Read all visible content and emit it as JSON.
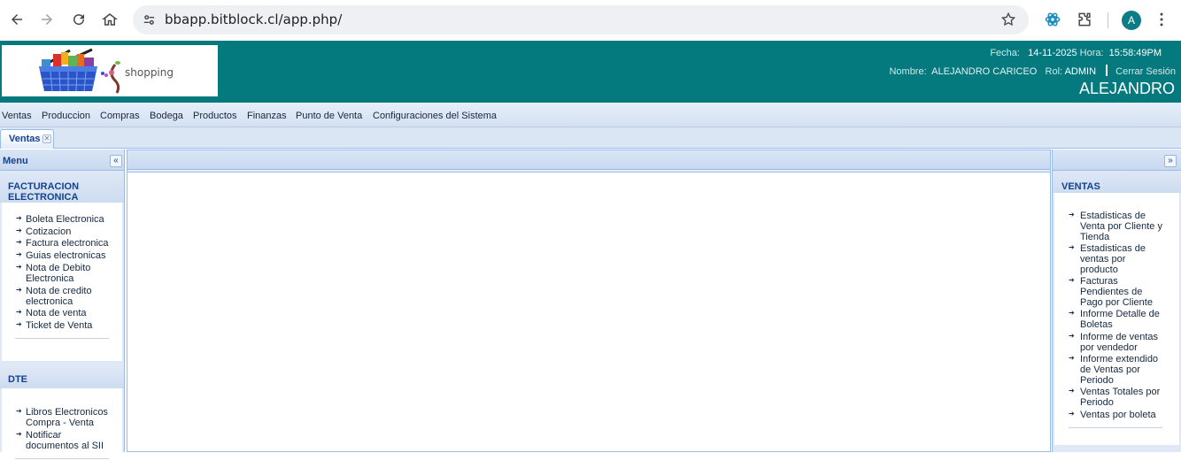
{
  "browser": {
    "url": "bbapp.bitblock.cl/app.php/",
    "avatar_letter": "A",
    "icons": [
      "back-arrow-icon",
      "forward-arrow-icon",
      "reload-icon",
      "home-icon",
      "site-settings-icon",
      "bookmark-star-icon",
      "extension-icon",
      "puzzle-icon",
      "kebab-menu-icon"
    ]
  },
  "header": {
    "logo_text": "shopping",
    "fecha_label": "Fecha:",
    "fecha_value": "14-11-2025",
    "hora_label": "Hora:",
    "hora_value": "15:58:49PM",
    "nombre_label": "Nombre:",
    "nombre_value": "ALEJANDRO CARICEO",
    "rol_label": "Rol:",
    "rol_value": "ADMIN",
    "logout_label": "Cerrar Sesión",
    "user_display": "ALEJANDRO",
    "bg_color": "#047a7f"
  },
  "menubar": [
    "Ventas",
    "Produccion",
    "Compras",
    "Bodega",
    "Productos",
    "Finanzas",
    "Punto de Venta",
    "Configuraciones del Sistema"
  ],
  "tabs": [
    {
      "label": "Ventas"
    }
  ],
  "west": {
    "title": "Menu",
    "sections": [
      {
        "title_line1": "FACTURACION",
        "title_line2": "ELECTRONICA",
        "items": [
          {
            "l1": "Boleta Electronica"
          },
          {
            "l1": "Cotizacion"
          },
          {
            "l1": "Factura electronica"
          },
          {
            "l1": "Guias electronicas"
          },
          {
            "l1": "Nota de Debito",
            "l2": "Electronica"
          },
          {
            "l1": "Nota de credito",
            "l2": "electronica"
          },
          {
            "l1": "Nota de venta"
          },
          {
            "l1": "Ticket de Venta"
          }
        ]
      },
      {
        "title_line1": "DTE",
        "items": [
          {
            "l1": "Libros Electronicos",
            "l2": "Compra - Venta"
          },
          {
            "l1": "Notificar",
            "l2": "documentos al SII"
          }
        ]
      }
    ]
  },
  "east": {
    "section_title": "VENTAS",
    "items": [
      {
        "l1": "Estadisticas de",
        "l2": "Venta por Cliente y",
        "l3": "Tienda"
      },
      {
        "l1": "Estadisticas de",
        "l2": "ventas por",
        "l3": "producto"
      },
      {
        "l1": "Facturas",
        "l2": "Pendientes de",
        "l3": "Pago por Cliente"
      },
      {
        "l1": "Informe Detalle de",
        "l2": "Boletas"
      },
      {
        "l1": "Informe de ventas",
        "l2": "por vendedor"
      },
      {
        "l1": "Informe extendido",
        "l2": "de Ventas por",
        "l3": "Periodo"
      },
      {
        "l1": "Ventas Totales por",
        "l2": "Periodo"
      },
      {
        "l1": "Ventas por boleta"
      }
    ]
  }
}
